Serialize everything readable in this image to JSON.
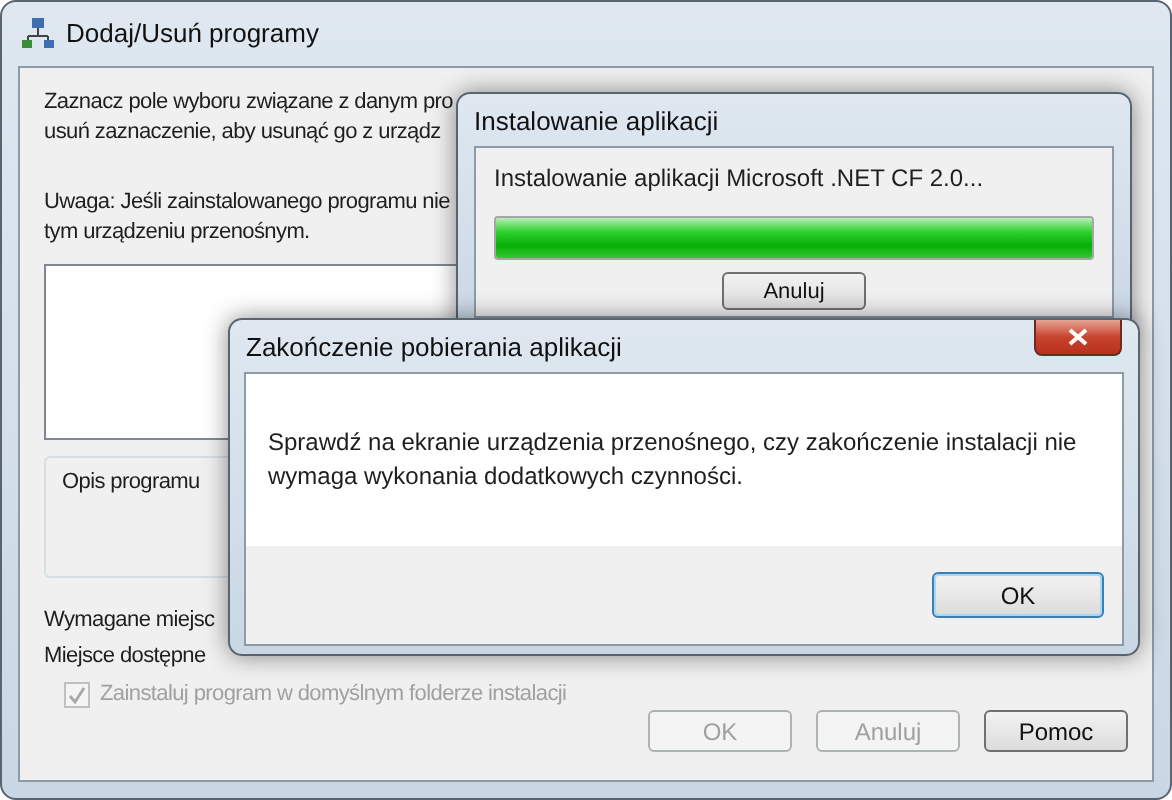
{
  "main_window": {
    "title": "Dodaj/Usuń programy",
    "intro_lines": [
      "Zaznacz pole wyboru związane z danym pro",
      "usuń zaznaczenie, aby usunąć go z urządz"
    ],
    "note_lines": [
      "Uwaga: Jeśli zainstalowanego programu nie",
      "tym urządzeniu przenośnym."
    ],
    "description_label": "Opis programu",
    "space_lines": [
      "Wymagane miejsc",
      "Miejsce dostępne"
    ],
    "checkbox": {
      "label": "Zainstaluj program w domyślnym folderze instalacji",
      "checked": true,
      "disabled": true
    },
    "buttons": [
      {
        "label": "OK",
        "disabled": true
      },
      {
        "label": "Anuluj",
        "disabled": true
      },
      {
        "label": "Pomoc",
        "disabled": false
      }
    ]
  },
  "install_window": {
    "title": "Instalowanie aplikacji",
    "status": "Instalowanie aplikacji Microsoft .NET CF 2.0...",
    "progress": {
      "level": 1
    },
    "button": {
      "label": "Anuluj"
    }
  },
  "completion_dialog": {
    "title": "Zakończenie pobierania aplikacji",
    "message": "Sprawdź na ekranie urządzenia przenośnego, czy zakończenie instalacji nie wymaga wykonania dodatkowych czynności.",
    "buttons": [
      {
        "label": "OK",
        "default": true
      }
    ]
  }
}
